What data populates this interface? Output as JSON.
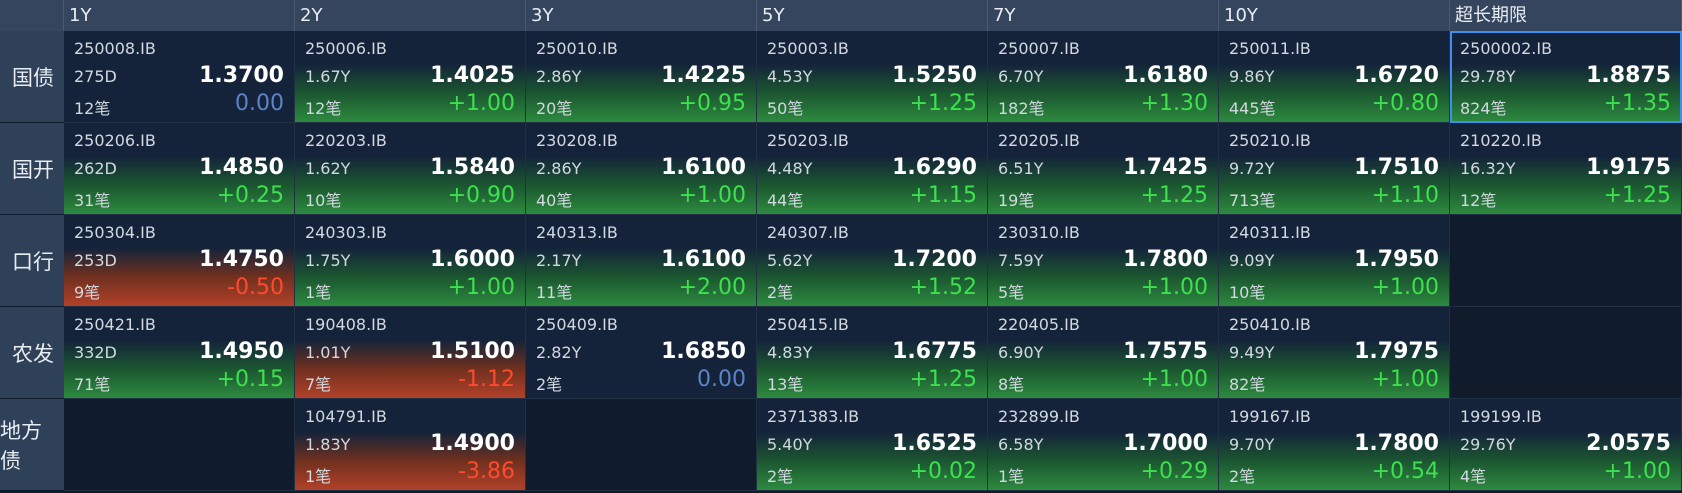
{
  "columns": [
    "1Y",
    "2Y",
    "3Y",
    "5Y",
    "7Y",
    "10Y",
    "超长期限"
  ],
  "rows": [
    {
      "label": "国债",
      "cells": [
        {
          "code": "250008.IB",
          "maturity": "275D",
          "yield": "1.3700",
          "count": "12笔",
          "change": "0.00",
          "dir": "flat"
        },
        {
          "code": "250006.IB",
          "maturity": "1.67Y",
          "yield": "1.4025",
          "count": "12笔",
          "change": "+1.00",
          "dir": "up"
        },
        {
          "code": "250010.IB",
          "maturity": "2.86Y",
          "yield": "1.4225",
          "count": "20笔",
          "change": "+0.95",
          "dir": "up"
        },
        {
          "code": "250003.IB",
          "maturity": "4.53Y",
          "yield": "1.5250",
          "count": "50笔",
          "change": "+1.25",
          "dir": "up"
        },
        {
          "code": "250007.IB",
          "maturity": "6.70Y",
          "yield": "1.6180",
          "count": "182笔",
          "change": "+1.30",
          "dir": "up"
        },
        {
          "code": "250011.IB",
          "maturity": "9.86Y",
          "yield": "1.6720",
          "count": "445笔",
          "change": "+0.80",
          "dir": "up"
        },
        {
          "code": "2500002.IB",
          "maturity": "29.78Y",
          "yield": "1.8875",
          "count": "824笔",
          "change": "+1.35",
          "dir": "up",
          "selected": true
        }
      ]
    },
    {
      "label": "国开",
      "cells": [
        {
          "code": "250206.IB",
          "maturity": "262D",
          "yield": "1.4850",
          "count": "31笔",
          "change": "+0.25",
          "dir": "up"
        },
        {
          "code": "220203.IB",
          "maturity": "1.62Y",
          "yield": "1.5840",
          "count": "10笔",
          "change": "+0.90",
          "dir": "up"
        },
        {
          "code": "230208.IB",
          "maturity": "2.86Y",
          "yield": "1.6100",
          "count": "40笔",
          "change": "+1.00",
          "dir": "up"
        },
        {
          "code": "250203.IB",
          "maturity": "4.48Y",
          "yield": "1.6290",
          "count": "44笔",
          "change": "+1.15",
          "dir": "up"
        },
        {
          "code": "220205.IB",
          "maturity": "6.51Y",
          "yield": "1.7425",
          "count": "19笔",
          "change": "+1.25",
          "dir": "up"
        },
        {
          "code": "250210.IB",
          "maturity": "9.72Y",
          "yield": "1.7510",
          "count": "713笔",
          "change": "+1.10",
          "dir": "up"
        },
        {
          "code": "210220.IB",
          "maturity": "16.32Y",
          "yield": "1.9175",
          "count": "12笔",
          "change": "+1.25",
          "dir": "up"
        }
      ]
    },
    {
      "label": "口行",
      "cells": [
        {
          "code": "250304.IB",
          "maturity": "253D",
          "yield": "1.4750",
          "count": "9笔",
          "change": "-0.50",
          "dir": "down"
        },
        {
          "code": "240303.IB",
          "maturity": "1.75Y",
          "yield": "1.6000",
          "count": "1笔",
          "change": "+1.00",
          "dir": "up"
        },
        {
          "code": "240313.IB",
          "maturity": "2.17Y",
          "yield": "1.6100",
          "count": "11笔",
          "change": "+2.00",
          "dir": "up"
        },
        {
          "code": "240307.IB",
          "maturity": "5.62Y",
          "yield": "1.7200",
          "count": "2笔",
          "change": "+1.52",
          "dir": "up"
        },
        {
          "code": "230310.IB",
          "maturity": "7.59Y",
          "yield": "1.7800",
          "count": "5笔",
          "change": "+1.00",
          "dir": "up"
        },
        {
          "code": "240311.IB",
          "maturity": "9.09Y",
          "yield": "1.7950",
          "count": "10笔",
          "change": "+1.00",
          "dir": "up"
        },
        null
      ]
    },
    {
      "label": "农发",
      "cells": [
        {
          "code": "250421.IB",
          "maturity": "332D",
          "yield": "1.4950",
          "count": "71笔",
          "change": "+0.15",
          "dir": "up"
        },
        {
          "code": "190408.IB",
          "maturity": "1.01Y",
          "yield": "1.5100",
          "count": "7笔",
          "change": "-1.12",
          "dir": "down"
        },
        {
          "code": "250409.IB",
          "maturity": "2.82Y",
          "yield": "1.6850",
          "count": "2笔",
          "change": "0.00",
          "dir": "flat"
        },
        {
          "code": "250415.IB",
          "maturity": "4.83Y",
          "yield": "1.6775",
          "count": "13笔",
          "change": "+1.25",
          "dir": "up"
        },
        {
          "code": "220405.IB",
          "maturity": "6.90Y",
          "yield": "1.7575",
          "count": "8笔",
          "change": "+1.00",
          "dir": "up"
        },
        {
          "code": "250410.IB",
          "maturity": "9.49Y",
          "yield": "1.7975",
          "count": "82笔",
          "change": "+1.00",
          "dir": "up"
        },
        null
      ]
    },
    {
      "label": "地方债",
      "cells": [
        null,
        {
          "code": "104791.IB",
          "maturity": "1.83Y",
          "yield": "1.4900",
          "count": "1笔",
          "change": "-3.86",
          "dir": "down"
        },
        null,
        {
          "code": "2371383.IB",
          "maturity": "5.40Y",
          "yield": "1.6525",
          "count": "2笔",
          "change": "+0.02",
          "dir": "up"
        },
        {
          "code": "232899.IB",
          "maturity": "6.58Y",
          "yield": "1.7000",
          "count": "1笔",
          "change": "+0.29",
          "dir": "up"
        },
        {
          "code": "199167.IB",
          "maturity": "9.70Y",
          "yield": "1.7800",
          "count": "2笔",
          "change": "+0.54",
          "dir": "up"
        },
        {
          "code": "199199.IB",
          "maturity": "29.76Y",
          "yield": "2.0575",
          "count": "4笔",
          "change": "+1.00",
          "dir": "up"
        }
      ]
    }
  ]
}
